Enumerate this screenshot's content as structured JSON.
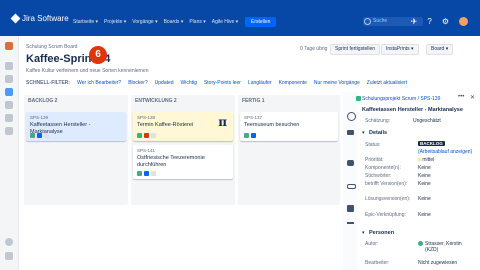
{
  "topbar": {
    "logo": "Jira Software",
    "nav": [
      "Startseite ▾",
      "Projekte ▾",
      "Vorgänge ▾",
      "Boards ▾",
      "Plans ▾",
      "Agile Hive ▾"
    ],
    "create": "Erstellen",
    "search_placeholder": "Suche"
  },
  "board": {
    "crumb": "Schulung Scrum Board",
    "title": "Kaffee-Sprint 34",
    "subtitle": "Kaffee Kultur verfeinern und neue Sorten kennenlernen",
    "badge": "6",
    "days": "0 Tage übrig",
    "complete_btn": "Sprint fertigstellen",
    "instaprints": "InstaPrints ▾",
    "board_btn": "Board ▾"
  },
  "filters": {
    "label": "SCHNELL-FILTER:",
    "items": [
      "Wer ich Bearbeiter?",
      "Blocker?",
      "Updated",
      "Wichtig",
      "Story-Points leer",
      "Langläufer",
      "Komponente",
      "Nur meine Vorgänge",
      "Zuletzt aktualisiert"
    ]
  },
  "columns": [
    {
      "name": "BACKLOG 2"
    },
    {
      "name": "ENTWICKLUNG 2"
    },
    {
      "name": "FERTIG 1"
    }
  ],
  "cards": [
    {
      "key": "SPS-139",
      "summary": "Kaffeetassen Hersteller - Marktanalyse"
    },
    {
      "key": "SPS-138",
      "summary": "Termin Kaffee-Rösterei",
      "glyph": "π"
    },
    {
      "key": "SPS-141",
      "summary": "Ostfriesische Teezeremonie durchführen"
    },
    {
      "key": "SPS-137",
      "summary": "Teemuseum besuchen"
    }
  ],
  "panel": {
    "crumb": "Schulungsprojekt Scrum / SPS-139",
    "title": "Kaffeetassen Hersteller - Marktanalyse",
    "estimate_label": "Schätzung:",
    "estimate_value": "Ungeschätzt",
    "details": "Details",
    "rows": [
      {
        "label": "Status:",
        "value": "BACKLOG"
      },
      {
        "label": "",
        "value": "(Arbeitsablauf anzeigen)"
      },
      {
        "label": "Priorität:",
        "value": "mittel"
      },
      {
        "label": "Komponente(n):",
        "value": "Keine"
      },
      {
        "label": "Stichwörter:",
        "value": "Keine"
      },
      {
        "label": "betrifft Version(en):",
        "value": "Keine"
      },
      {
        "label": "Lösungsversion(en):",
        "value": "Keine"
      },
      {
        "label": "Epic-Verknüpfung:",
        "value": "Keine"
      }
    ],
    "people": "Personen",
    "autor_label": "Autor:",
    "autor_value": "Strasser, Kerstin (KZD)",
    "bearbeiter_label": "Bearbeiter:",
    "bearbeiter_value": "Nicht zugewiesen"
  },
  "colors": {
    "topbar": "#0747a6",
    "accent": "#0052cc",
    "badge": "#de350b"
  }
}
